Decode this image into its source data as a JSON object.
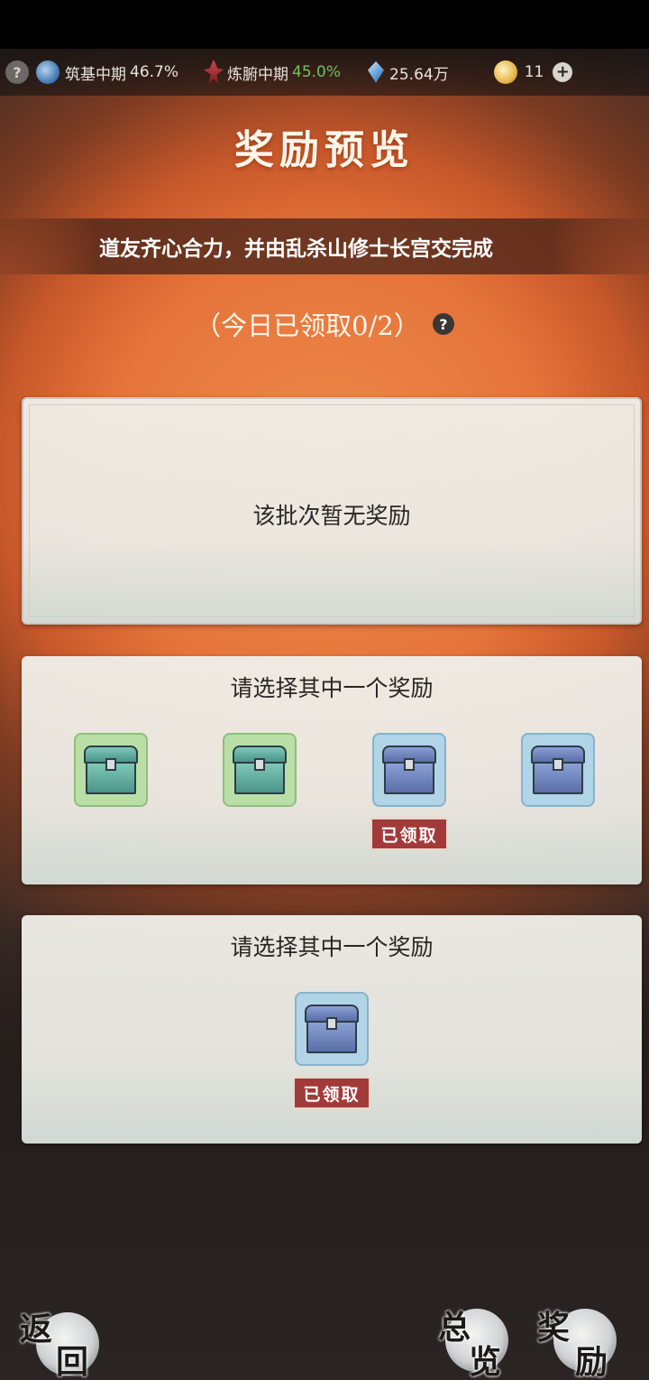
{
  "status_bar": {
    "help_symbol": "?",
    "realm": {
      "label": "筑基中期",
      "percent": "46.7%"
    },
    "body": {
      "label": "炼腑中期",
      "percent": "45.0%"
    },
    "spirit_stones": "25.64万",
    "currency_count": "11",
    "plus_symbol": "+"
  },
  "title": "奖励预览",
  "marquee_text": "道友齐心合力，并由乱杀山修士长宫交完成",
  "claim_status": "（今日已领取0/2）",
  "claim_help_symbol": "?",
  "panels": {
    "empty_batch": {
      "message": "该批次暂无奖励"
    },
    "choice_group_1": {
      "heading": "请选择其中一个奖励",
      "items": [
        {
          "rarity": "green",
          "icon": "chest-icon",
          "claimed": false
        },
        {
          "rarity": "green",
          "icon": "chest-icon",
          "claimed": false
        },
        {
          "rarity": "blue",
          "icon": "chest-icon",
          "claimed": true,
          "claimed_label": "已领取"
        },
        {
          "rarity": "blue",
          "icon": "chest-icon",
          "claimed": false
        }
      ]
    },
    "choice_group_2": {
      "heading": "请选择其中一个奖励",
      "items": [
        {
          "rarity": "blue",
          "icon": "chest-icon",
          "claimed": true,
          "claimed_label": "已领取"
        }
      ]
    }
  },
  "nav": {
    "back": {
      "char1": "返",
      "char2": "回"
    },
    "overview": {
      "char1": "总",
      "char2": "览"
    },
    "rewards": {
      "char1": "奖",
      "char2": "励"
    }
  },
  "colors": {
    "accent_green": "#6fc25e",
    "claimed_red": "#a33a3a",
    "slot_green": "#b9dfa6",
    "slot_blue": "#b1d4e6"
  }
}
